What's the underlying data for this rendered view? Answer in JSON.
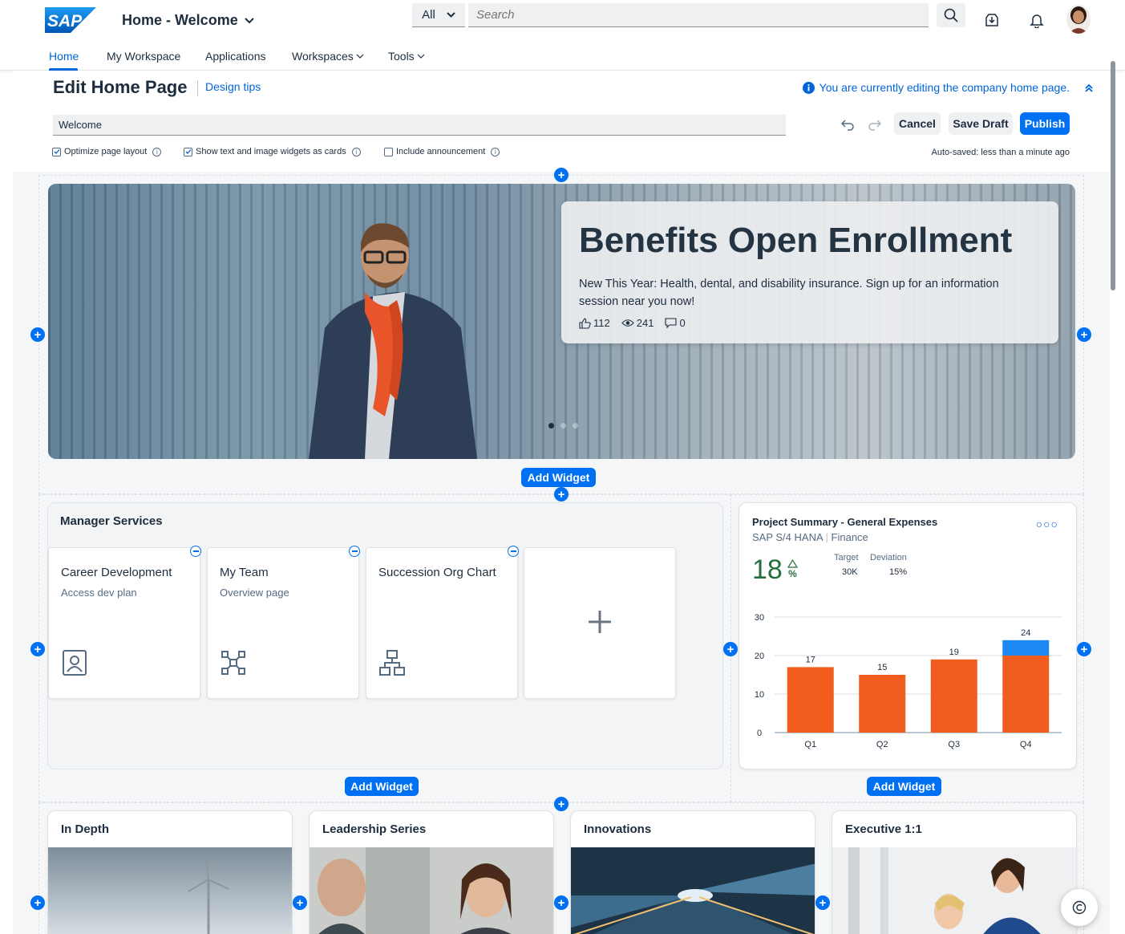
{
  "shell": {
    "logo_text": "SAP",
    "app_title": "Home - Welcome",
    "search_scope": "All",
    "search_placeholder": "Search",
    "icons": [
      "search-icon",
      "inbox-download-icon",
      "bell-icon",
      "avatar"
    ]
  },
  "nav": {
    "items": [
      {
        "label": "Home",
        "active": true
      },
      {
        "label": "My Workspace"
      },
      {
        "label": "Applications"
      },
      {
        "label": "Workspaces",
        "dropdown": true
      },
      {
        "label": "Tools",
        "dropdown": true
      }
    ]
  },
  "edit": {
    "title": "Edit Home Page",
    "design_tips": "Design tips",
    "info_message": "You are currently editing the company home page.",
    "page_title_value": "Welcome",
    "cancel": "Cancel",
    "save_draft": "Save Draft",
    "publish": "Publish",
    "checks": [
      {
        "label": "Optimize page layout",
        "checked": true
      },
      {
        "label": "Show text and image widgets as cards",
        "checked": true
      },
      {
        "label": "Include announcement",
        "checked": false
      }
    ],
    "autosave": "Auto-saved: less than a minute ago"
  },
  "hero": {
    "title": "Benefits Open Enrollment",
    "text": "New This Year: Health, dental, and disability insurance. Sign up for an information session near you now!",
    "likes": "112",
    "views": "241",
    "comments": "0",
    "slides": 3,
    "active_slide": 1
  },
  "add_widget_label": "Add Widget",
  "manager_services": {
    "title": "Manager Services",
    "tiles": [
      {
        "title": "Career Development",
        "subtitle": "Access dev plan",
        "icon": "employee-badge-icon"
      },
      {
        "title": "My Team",
        "subtitle": "Overview page",
        "icon": "team-network-icon"
      },
      {
        "title": "Succession Org Chart",
        "subtitle": "",
        "icon": "org-chart-icon"
      }
    ],
    "add_tile_icon": "plus-icon"
  },
  "project_summary": {
    "title": "Project Summary - General Expenses",
    "subtitle_a": "SAP S/4 HANA",
    "subtitle_b": "Finance",
    "kpi_value": "18",
    "kpi_unit": "%",
    "kpi_trend": "up",
    "target_label": "Target",
    "target_value": "30K",
    "deviation_label": "Deviation",
    "deviation_value": "15%",
    "colors": {
      "bar": "#f15d1f",
      "overflow": "#1c8af2",
      "kpi": "#256f3a"
    }
  },
  "chart_data": {
    "type": "bar",
    "categories": [
      "Q1",
      "Q2",
      "Q3",
      "Q4"
    ],
    "values": [
      17,
      15,
      19,
      24
    ],
    "ylim": [
      0,
      30
    ],
    "yticks": [
      "0",
      "10",
      "20",
      "30"
    ],
    "target_line": 20,
    "grid": true
  },
  "bottom_cards": [
    {
      "title": "In Depth"
    },
    {
      "title": "Leadership Series"
    },
    {
      "title": "Innovations"
    },
    {
      "title": "Executive 1:1"
    }
  ]
}
